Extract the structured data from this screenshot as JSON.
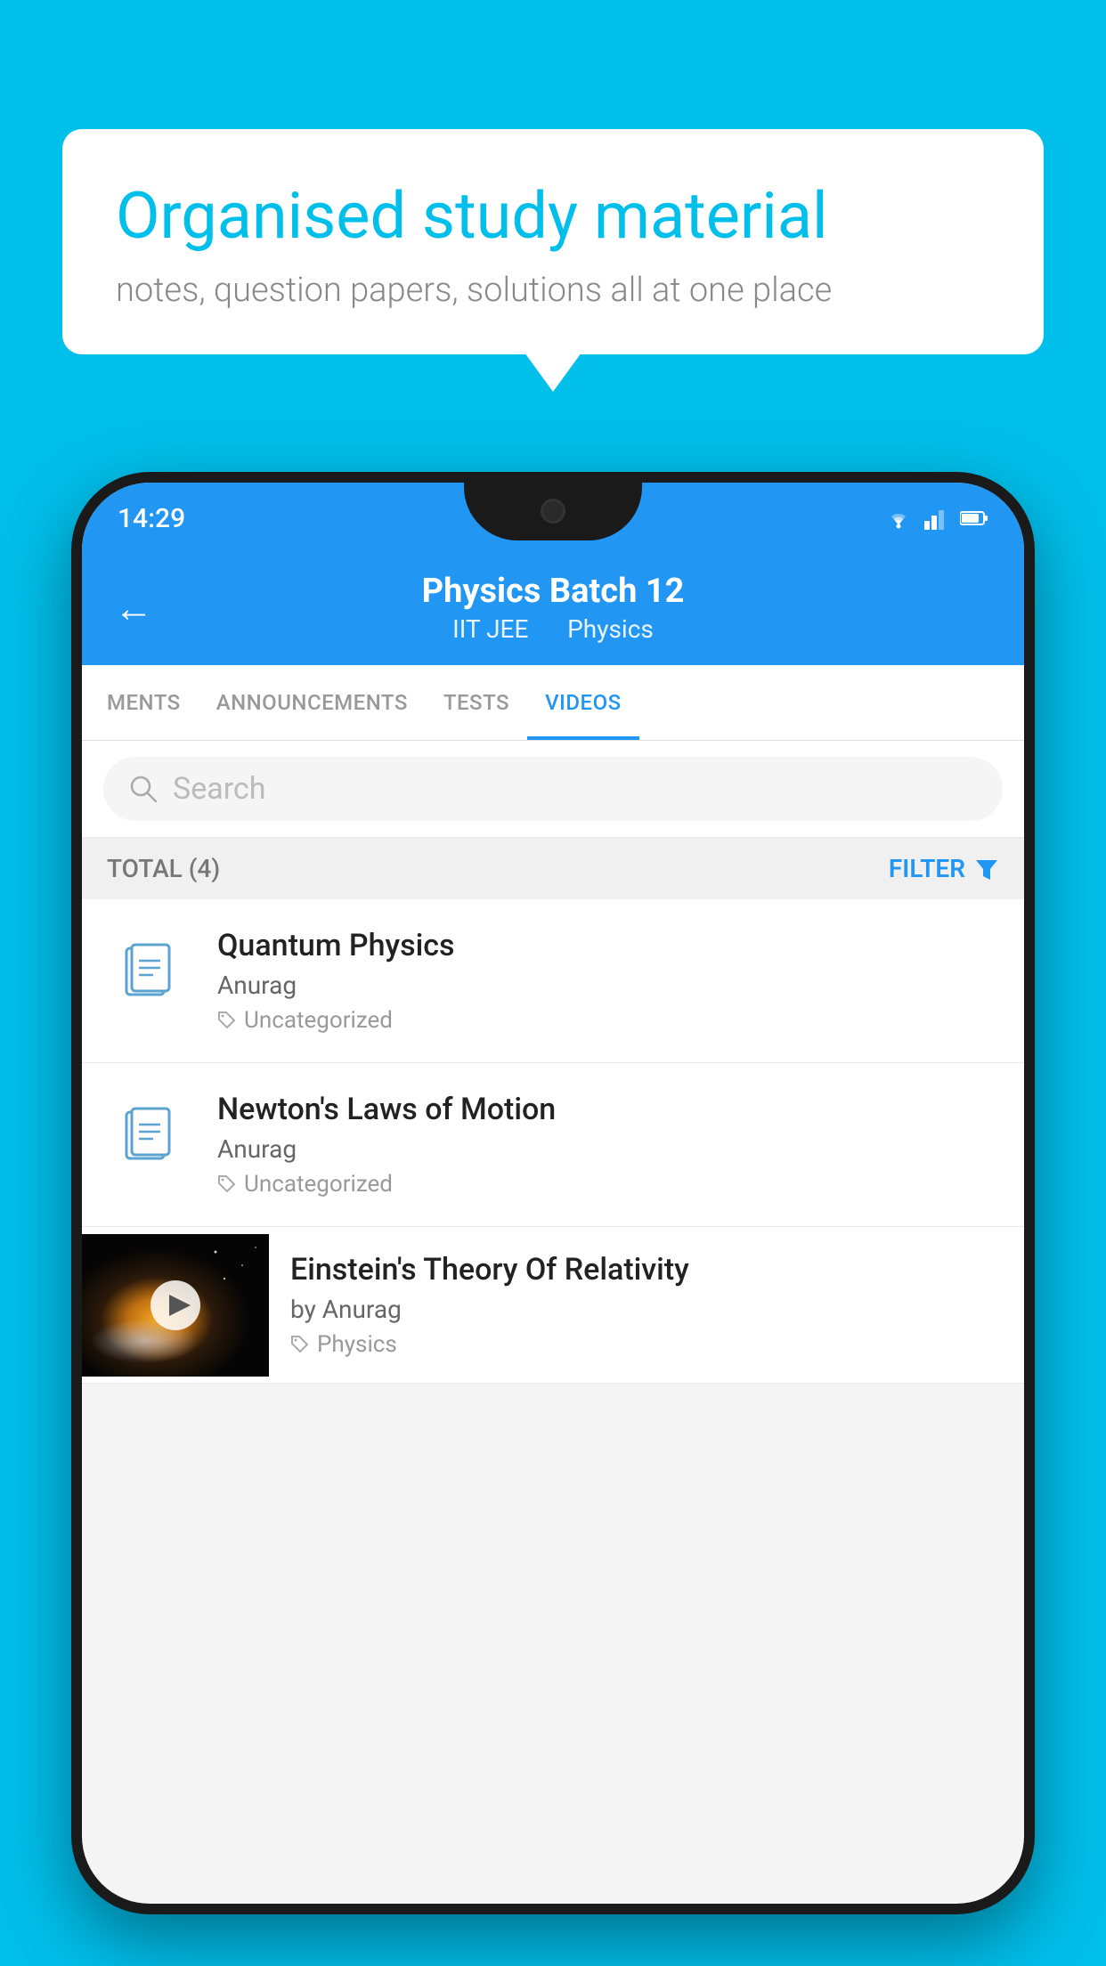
{
  "bubble": {
    "title": "Organised study material",
    "subtitle": "notes, question papers, solutions all at one place"
  },
  "statusBar": {
    "time": "14:29"
  },
  "header": {
    "title": "Physics Batch 12",
    "subtitle1": "IIT JEE",
    "subtitle2": "Physics"
  },
  "tabs": [
    {
      "label": "MENTS",
      "active": false
    },
    {
      "label": "ANNOUNCEMENTS",
      "active": false
    },
    {
      "label": "TESTS",
      "active": false
    },
    {
      "label": "VIDEOS",
      "active": true
    }
  ],
  "search": {
    "placeholder": "Search"
  },
  "filterBar": {
    "total": "TOTAL (4)",
    "filterLabel": "FILTER"
  },
  "videos": [
    {
      "title": "Quantum Physics",
      "author": "Anurag",
      "tag": "Uncategorized",
      "hasThumb": false
    },
    {
      "title": "Newton's Laws of Motion",
      "author": "Anurag",
      "tag": "Uncategorized",
      "hasThumb": false
    },
    {
      "title": "Einstein's Theory Of Relativity",
      "author": "by Anurag",
      "tag": "Physics",
      "hasThumb": true
    }
  ]
}
